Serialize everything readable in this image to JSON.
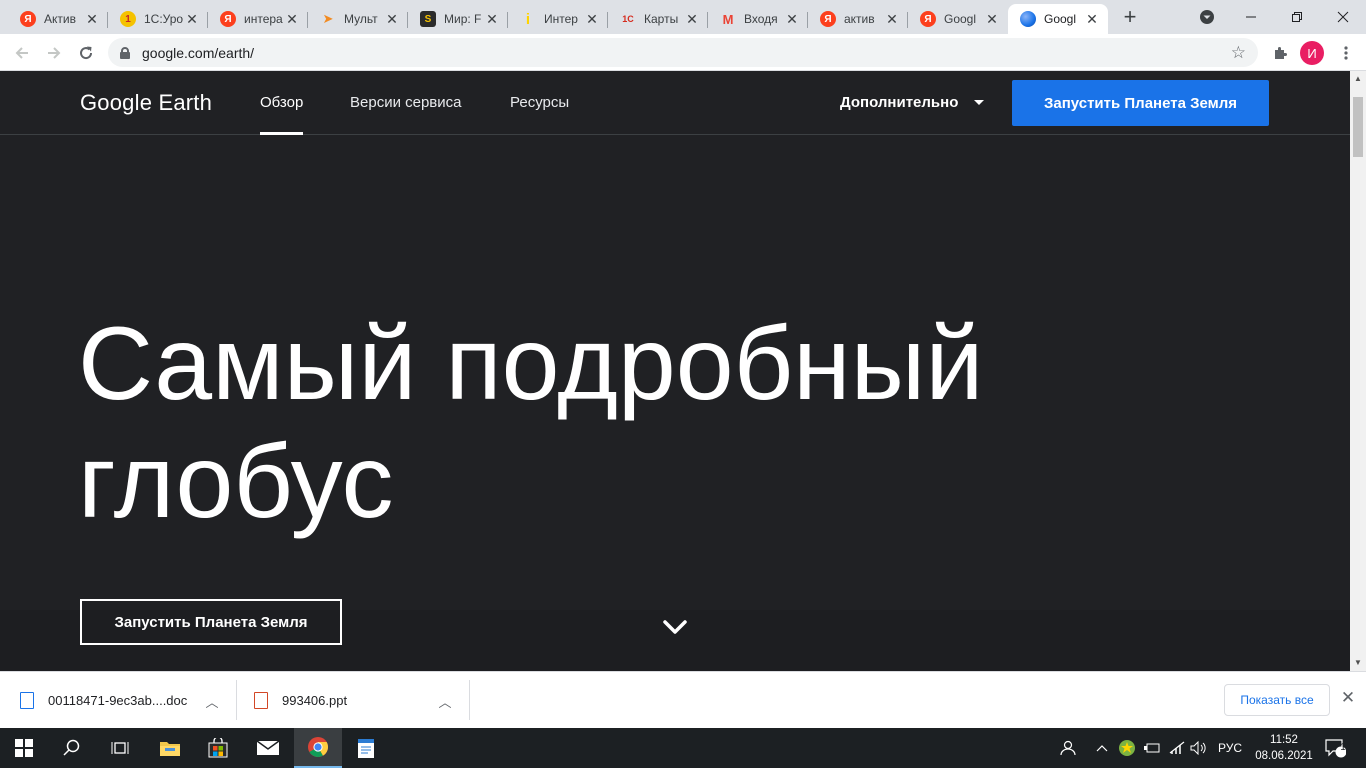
{
  "browser": {
    "tabs": [
      {
        "title": "Актив",
        "favicon": "yandex-icon",
        "color": "#fc3f1d",
        "glyph": "Я"
      },
      {
        "title": "1С:Уро",
        "favicon": "1c-uroki-icon",
        "color": "#f5c200",
        "glyph": "1"
      },
      {
        "title": "интера",
        "favicon": "yandex-icon",
        "color": "#fc3f1d",
        "glyph": "Я"
      },
      {
        "title": "Мульт",
        "favicon": "paper-plane-icon",
        "color": "#f28b22",
        "glyph": "➤"
      },
      {
        "title": "Мир: F",
        "favicon": "mir-icon",
        "color": "#2b2b2b",
        "glyph": "S"
      },
      {
        "title": "Интер",
        "favicon": "info-icon",
        "color": "#ffd400",
        "glyph": "i"
      },
      {
        "title": "Карты",
        "favicon": "1c-icon",
        "color": "#d52b1e",
        "glyph": "1С"
      },
      {
        "title": "Входя",
        "favicon": "gmail-icon",
        "color": "#ea4335",
        "glyph": "M"
      },
      {
        "title": "актив",
        "favicon": "yandex-icon",
        "color": "#fc3f1d",
        "glyph": "Я"
      },
      {
        "title": "Googl",
        "favicon": "yandex-icon",
        "color": "#fc3f1d",
        "glyph": "Я"
      },
      {
        "title": "Googl",
        "favicon": "google-earth-icon",
        "color": "#4285f4",
        "glyph": "",
        "active": true
      }
    ],
    "url": "google.com/earth/",
    "profile_initial": "И"
  },
  "site": {
    "logo": "Google Earth",
    "nav": [
      "Обзор",
      "Версии сервиса",
      "Ресурсы"
    ],
    "more_label": "Дополнительно",
    "cta_top": "Запустить Планета Земля",
    "hero_line1": "Самый подробный",
    "hero_line2": "глобус",
    "cta_hero": "Запустить Планета Земля",
    "accent": "#1a73e8",
    "background": "#202124"
  },
  "downloads": {
    "items": [
      {
        "name": "00118471-9ec3ab....doc",
        "type": "doc-icon"
      },
      {
        "name": "993406.ppt",
        "type": "ppt-icon"
      }
    ],
    "show_all": "Показать все"
  },
  "taskbar": {
    "language": "РУС",
    "time": "11:52",
    "date": "08.06.2021",
    "notifications": "1"
  }
}
